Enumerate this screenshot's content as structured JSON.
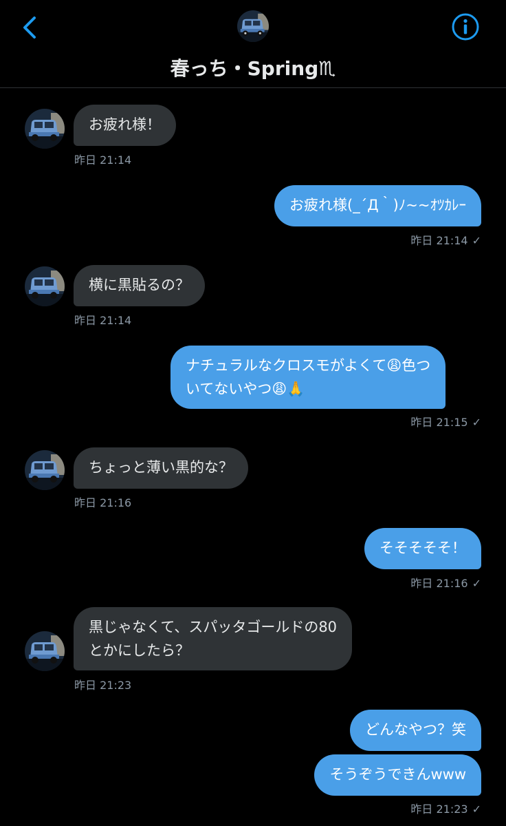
{
  "header": {
    "title": "春っち・Spring♏︎"
  },
  "messages": [
    {
      "dir": "in",
      "text": "お疲れ様！",
      "time": "昨日 21:14"
    },
    {
      "dir": "out",
      "text": "お疲れ様(_´Д｀)ﾉ~~ｵﾂｶﾚｰ",
      "time": "昨日 21:14"
    },
    {
      "dir": "in",
      "text": "横に黒貼るの？",
      "time": "昨日 21:14"
    },
    {
      "dir": "out",
      "line1": "ナチュラルなクロスモがよくて😩色つ",
      "line2": "いてないやつ😩🙏",
      "time": "昨日 21:15"
    },
    {
      "dir": "in",
      "text": "ちょっと薄い黒的な？",
      "time": "昨日 21:16"
    },
    {
      "dir": "out",
      "text": "そそそそそ！",
      "time": "昨日 21:16"
    },
    {
      "dir": "in",
      "line1": "黒じゃなくて、スパッタゴールドの80",
      "line2": "とかにしたら？",
      "time": "昨日 21:23"
    },
    {
      "dir": "out",
      "text": "どんなやつ？笑"
    },
    {
      "dir": "out",
      "text": "そうぞうできんwww",
      "time": "昨日 21:23"
    }
  ],
  "read_mark": "✓",
  "colors": {
    "accent": "#1d9bf0",
    "outgoing_bubble": "#4a9fe8",
    "incoming_bubble": "#2f3336",
    "background": "#000000"
  },
  "icons": {
    "back": "chevron-left-icon",
    "info": "info-circle-icon",
    "avatar": "car-avatar"
  }
}
